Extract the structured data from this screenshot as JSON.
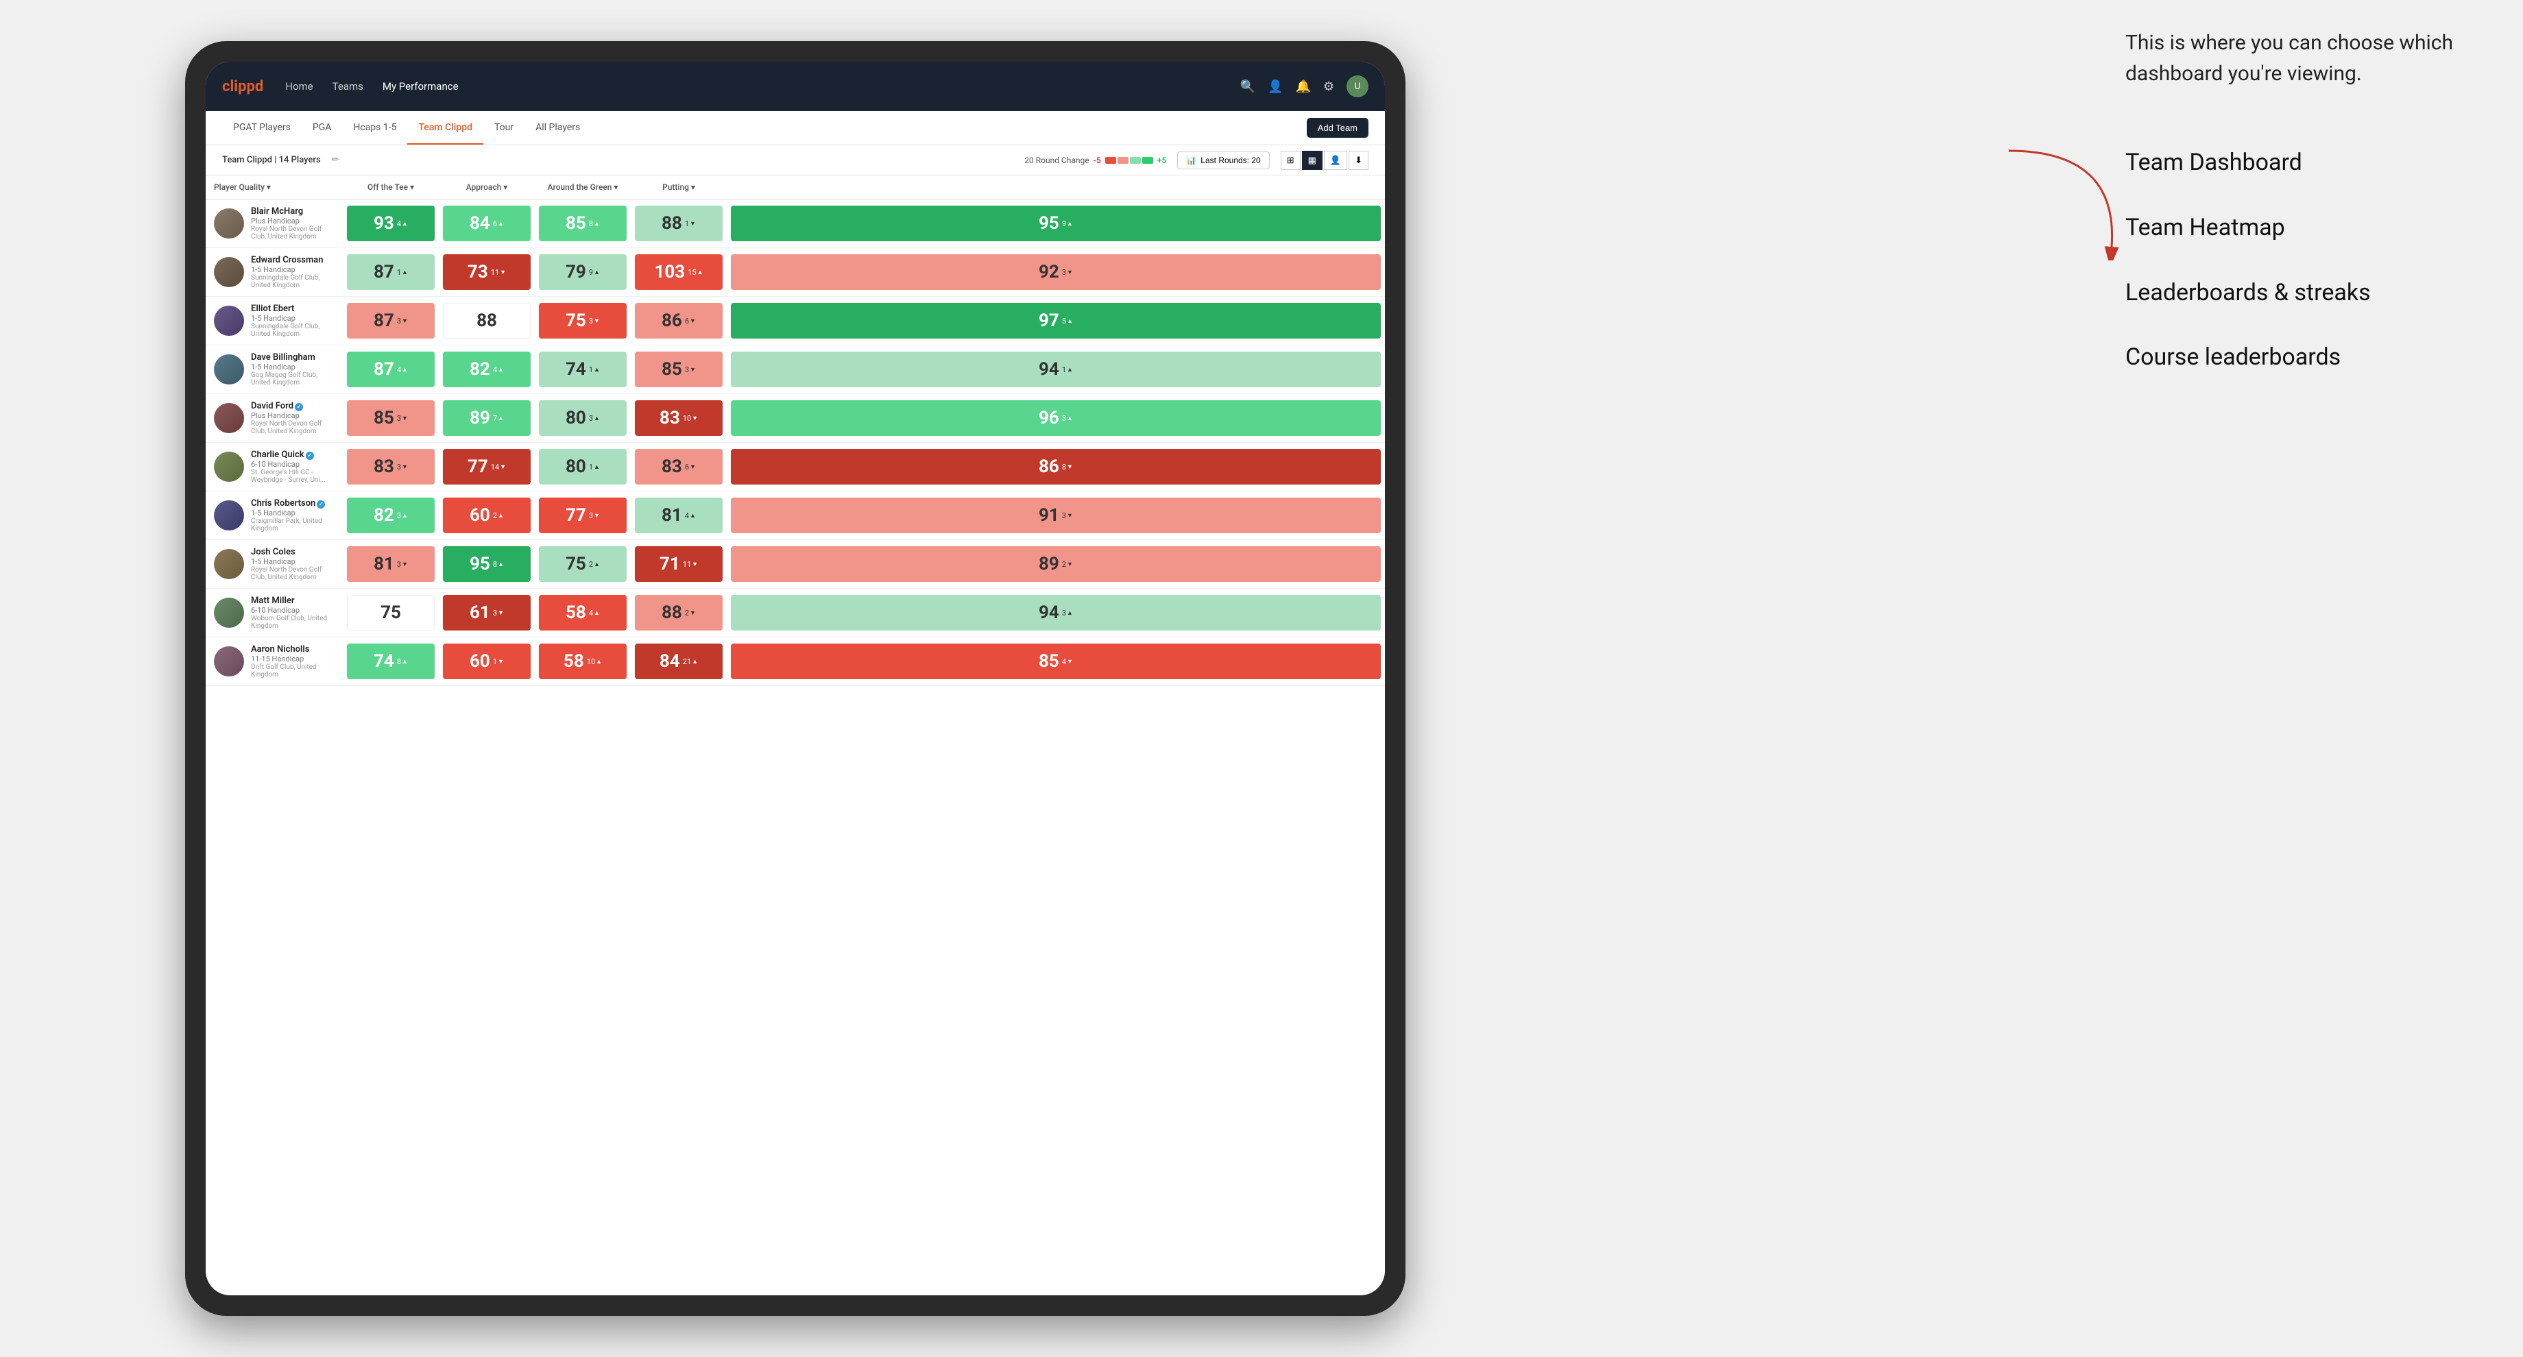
{
  "annotation": {
    "intro": "This is where you can choose which dashboard you're viewing.",
    "items": [
      "Team Dashboard",
      "Team Heatmap",
      "Leaderboards & streaks",
      "Course leaderboards"
    ]
  },
  "navbar": {
    "brand": "clippd",
    "links": [
      "Home",
      "Teams",
      "My Performance"
    ],
    "active_link": "My Performance"
  },
  "tabs": {
    "items": [
      "PGAT Players",
      "PGA",
      "Hcaps 1-5",
      "Team Clippd",
      "Tour",
      "All Players"
    ],
    "active": "Team Clippd",
    "add_button": "Add Team"
  },
  "subheader": {
    "team_name": "Team Clippd",
    "player_count": "14 Players",
    "round_change_label": "20 Round Change",
    "change_neg": "-5",
    "change_pos": "+5",
    "last_rounds_label": "Last Rounds:",
    "last_rounds_value": "20"
  },
  "table": {
    "columns": {
      "player": "Player Quality",
      "off_tee": "Off the Tee",
      "approach": "Approach",
      "around_green": "Around the Green",
      "putting": "Putting"
    },
    "players": [
      {
        "name": "Blair McHarg",
        "handicap": "Plus Handicap",
        "club": "Royal North Devon Golf Club, United Kingdom",
        "avatar_class": "av1",
        "stats": {
          "quality": {
            "value": "93",
            "change": "4",
            "dir": "up",
            "color": "bg-green-strong"
          },
          "off_tee": {
            "value": "84",
            "change": "6",
            "dir": "up",
            "color": "bg-green-mid"
          },
          "approach": {
            "value": "85",
            "change": "8",
            "dir": "up",
            "color": "bg-green-mid"
          },
          "around_green": {
            "value": "88",
            "change": "1",
            "dir": "down",
            "color": "bg-green-light"
          },
          "putting": {
            "value": "95",
            "change": "9",
            "dir": "up",
            "color": "bg-green-strong"
          }
        }
      },
      {
        "name": "Edward Crossman",
        "handicap": "1-5 Handicap",
        "club": "Sunningdale Golf Club, United Kingdom",
        "avatar_class": "av2",
        "stats": {
          "quality": {
            "value": "87",
            "change": "1",
            "dir": "up",
            "color": "bg-green-light"
          },
          "off_tee": {
            "value": "73",
            "change": "11",
            "dir": "down",
            "color": "bg-red-strong"
          },
          "approach": {
            "value": "79",
            "change": "9",
            "dir": "up",
            "color": "bg-green-light"
          },
          "around_green": {
            "value": "103",
            "change": "15",
            "dir": "up",
            "color": "bg-red-mid"
          },
          "putting": {
            "value": "92",
            "change": "3",
            "dir": "down",
            "color": "bg-red-light"
          }
        }
      },
      {
        "name": "Elliot Ebert",
        "handicap": "1-5 Handicap",
        "club": "Sunningdale Golf Club, United Kingdom",
        "avatar_class": "av3",
        "stats": {
          "quality": {
            "value": "87",
            "change": "3",
            "dir": "down",
            "color": "bg-red-light"
          },
          "off_tee": {
            "value": "88",
            "change": "",
            "dir": "",
            "color": "bg-white"
          },
          "approach": {
            "value": "75",
            "change": "3",
            "dir": "down",
            "color": "bg-red-mid"
          },
          "around_green": {
            "value": "86",
            "change": "6",
            "dir": "down",
            "color": "bg-red-light"
          },
          "putting": {
            "value": "97",
            "change": "5",
            "dir": "up",
            "color": "bg-green-strong"
          }
        }
      },
      {
        "name": "Dave Billingham",
        "handicap": "1-5 Handicap",
        "club": "Gog Magog Golf Club, United Kingdom",
        "avatar_class": "av4",
        "stats": {
          "quality": {
            "value": "87",
            "change": "4",
            "dir": "up",
            "color": "bg-green-mid"
          },
          "off_tee": {
            "value": "82",
            "change": "4",
            "dir": "up",
            "color": "bg-green-mid"
          },
          "approach": {
            "value": "74",
            "change": "1",
            "dir": "up",
            "color": "bg-green-light"
          },
          "around_green": {
            "value": "85",
            "change": "3",
            "dir": "down",
            "color": "bg-red-light"
          },
          "putting": {
            "value": "94",
            "change": "1",
            "dir": "up",
            "color": "bg-green-light"
          }
        }
      },
      {
        "name": "David Ford",
        "handicap": "Plus Handicap",
        "club": "Royal North Devon Golf Club, United Kingdom",
        "avatar_class": "av5",
        "verified": true,
        "stats": {
          "quality": {
            "value": "85",
            "change": "3",
            "dir": "down",
            "color": "bg-red-light"
          },
          "off_tee": {
            "value": "89",
            "change": "7",
            "dir": "up",
            "color": "bg-green-mid"
          },
          "approach": {
            "value": "80",
            "change": "3",
            "dir": "up",
            "color": "bg-green-light"
          },
          "around_green": {
            "value": "83",
            "change": "10",
            "dir": "down",
            "color": "bg-red-strong"
          },
          "putting": {
            "value": "96",
            "change": "3",
            "dir": "up",
            "color": "bg-green-mid"
          }
        }
      },
      {
        "name": "Charlie Quick",
        "handicap": "6-10 Handicap",
        "club": "St. George's Hill GC - Weybridge - Surrey, Uni...",
        "avatar_class": "av6",
        "verified": true,
        "stats": {
          "quality": {
            "value": "83",
            "change": "3",
            "dir": "down",
            "color": "bg-red-light"
          },
          "off_tee": {
            "value": "77",
            "change": "14",
            "dir": "down",
            "color": "bg-red-strong"
          },
          "approach": {
            "value": "80",
            "change": "1",
            "dir": "up",
            "color": "bg-green-light"
          },
          "around_green": {
            "value": "83",
            "change": "6",
            "dir": "down",
            "color": "bg-red-light"
          },
          "putting": {
            "value": "86",
            "change": "8",
            "dir": "down",
            "color": "bg-red-strong"
          }
        }
      },
      {
        "name": "Chris Robertson",
        "handicap": "1-5 Handicap",
        "club": "Craigmillar Park, United Kingdom",
        "avatar_class": "av7",
        "verified": true,
        "stats": {
          "quality": {
            "value": "82",
            "change": "3",
            "dir": "up",
            "color": "bg-green-mid"
          },
          "off_tee": {
            "value": "60",
            "change": "2",
            "dir": "up",
            "color": "bg-red-mid"
          },
          "approach": {
            "value": "77",
            "change": "3",
            "dir": "down",
            "color": "bg-red-mid"
          },
          "around_green": {
            "value": "81",
            "change": "4",
            "dir": "up",
            "color": "bg-green-light"
          },
          "putting": {
            "value": "91",
            "change": "3",
            "dir": "down",
            "color": "bg-red-light"
          }
        }
      },
      {
        "name": "Josh Coles",
        "handicap": "1-5 Handicap",
        "club": "Royal North Devon Golf Club, United Kingdom",
        "avatar_class": "av8",
        "stats": {
          "quality": {
            "value": "81",
            "change": "3",
            "dir": "down",
            "color": "bg-red-light"
          },
          "off_tee": {
            "value": "95",
            "change": "8",
            "dir": "up",
            "color": "bg-green-strong"
          },
          "approach": {
            "value": "75",
            "change": "2",
            "dir": "up",
            "color": "bg-green-light"
          },
          "around_green": {
            "value": "71",
            "change": "11",
            "dir": "down",
            "color": "bg-red-strong"
          },
          "putting": {
            "value": "89",
            "change": "2",
            "dir": "down",
            "color": "bg-red-light"
          }
        }
      },
      {
        "name": "Matt Miller",
        "handicap": "6-10 Handicap",
        "club": "Woburn Golf Club, United Kingdom",
        "avatar_class": "av9",
        "stats": {
          "quality": {
            "value": "75",
            "change": "",
            "dir": "",
            "color": "bg-white"
          },
          "off_tee": {
            "value": "61",
            "change": "3",
            "dir": "down",
            "color": "bg-red-strong"
          },
          "approach": {
            "value": "58",
            "change": "4",
            "dir": "up",
            "color": "bg-red-mid"
          },
          "around_green": {
            "value": "88",
            "change": "2",
            "dir": "down",
            "color": "bg-red-light"
          },
          "putting": {
            "value": "94",
            "change": "3",
            "dir": "up",
            "color": "bg-green-light"
          }
        }
      },
      {
        "name": "Aaron Nicholls",
        "handicap": "11-15 Handicap",
        "club": "Drift Golf Club, United Kingdom",
        "avatar_class": "av10",
        "stats": {
          "quality": {
            "value": "74",
            "change": "8",
            "dir": "up",
            "color": "bg-green-mid"
          },
          "off_tee": {
            "value": "60",
            "change": "1",
            "dir": "down",
            "color": "bg-red-mid"
          },
          "approach": {
            "value": "58",
            "change": "10",
            "dir": "up",
            "color": "bg-red-mid"
          },
          "around_green": {
            "value": "84",
            "change": "21",
            "dir": "up",
            "color": "bg-red-strong"
          },
          "putting": {
            "value": "85",
            "change": "4",
            "dir": "down",
            "color": "bg-red-mid"
          }
        }
      }
    ]
  }
}
